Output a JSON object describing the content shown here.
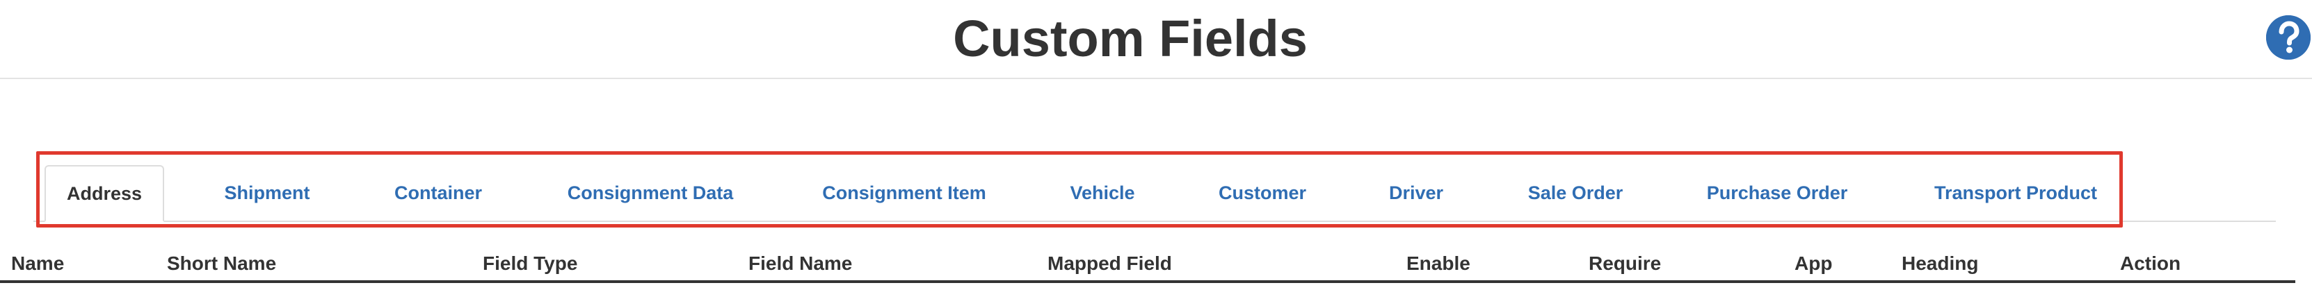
{
  "header": {
    "title": "Custom Fields",
    "help_icon": "question-circle-icon",
    "help_color": "#2f6db3"
  },
  "tabs": [
    {
      "label": "Address",
      "active": true
    },
    {
      "label": "Shipment",
      "active": false
    },
    {
      "label": "Container",
      "active": false
    },
    {
      "label": "Consignment Data",
      "active": false
    },
    {
      "label": "Consignment Item",
      "active": false
    },
    {
      "label": "Vehicle",
      "active": false
    },
    {
      "label": "Customer",
      "active": false
    },
    {
      "label": "Driver",
      "active": false
    },
    {
      "label": "Sale Order",
      "active": false
    },
    {
      "label": "Purchase Order",
      "active": false
    },
    {
      "label": "Transport Product",
      "active": false
    }
  ],
  "table": {
    "columns": [
      "Name",
      "Short Name",
      "Field Type",
      "Field Name",
      "Mapped Field",
      "Enable",
      "Require",
      "App",
      "Heading",
      "Action"
    ]
  },
  "colors": {
    "link": "#2f6db3",
    "highlight_border": "#e0392e",
    "text": "#333333"
  }
}
